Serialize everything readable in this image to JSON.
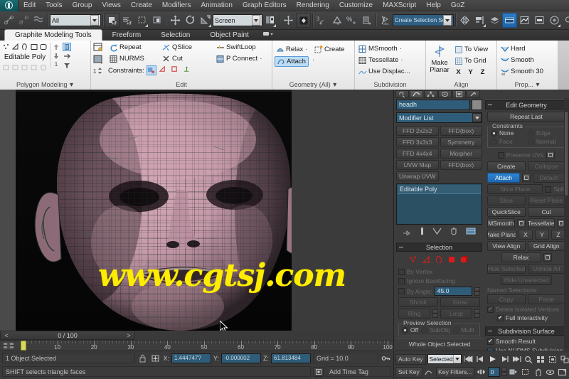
{
  "menubar": {
    "logo": "max-logo-icon",
    "items": [
      "Edit",
      "Tools",
      "Group",
      "Views",
      "Create",
      "Modifiers",
      "Animation",
      "Graph Editors",
      "Rendering",
      "Customize",
      "MAXScript",
      "Help",
      "GoZ"
    ]
  },
  "toolbar": {
    "selection_filter": "All",
    "reference_coord": "Screen",
    "named_selection_set": "Create Selection Set",
    "icons": [
      "undo-icon",
      "redo-icon",
      "select-link-icon",
      "unlink-icon",
      "bind-space-warp-icon",
      "select-object-icon",
      "select-by-name-icon",
      "rectangular-select-icon",
      "window-crossing-icon",
      "select-move-icon",
      "select-rotate-icon",
      "select-scale-icon",
      "use-pivot-center-icon",
      "select-manipulate-icon",
      "snap-toggle-icon",
      "angle-snap-icon",
      "percent-snap-icon",
      "spinner-snap-icon",
      "edit-named-sets-icon",
      "mirror-icon",
      "align-icon",
      "layer-manager-icon",
      "graphite-toggle-icon",
      "curve-editor-icon",
      "schematic-view-icon",
      "material-editor-icon",
      "render-setup-icon",
      "render-frame-icon"
    ]
  },
  "ribbon": {
    "tabs": [
      {
        "label": "Graphite Modeling Tools",
        "active": true
      },
      {
        "label": "Freeform",
        "active": false
      },
      {
        "label": "Selection",
        "active": false
      },
      {
        "label": "Object Paint",
        "active": false
      }
    ],
    "panels": [
      {
        "title": "Polygon Modeling",
        "subobject_label": "Editable Poly",
        "has_dropdown": true
      },
      {
        "title": "Edit",
        "buttons": [
          "Repeat",
          "QSlice",
          "SwiftLoop",
          "NURMS",
          "Cut",
          "P Connect"
        ],
        "constraints_label": "Constraints:",
        "spinner_value": "1"
      },
      {
        "title": "Geometry (All)",
        "buttons": [
          "Relax",
          "Create",
          "Attach"
        ],
        "selected": "Attach"
      },
      {
        "title": "Subdivision",
        "buttons": [
          "MSmooth",
          "Tessellate",
          "Use Displac..."
        ]
      },
      {
        "title": "Align",
        "make_planar": "Make Planar",
        "buttons": [
          "To View",
          "To Grid"
        ],
        "axes": [
          "X",
          "Y",
          "Z"
        ]
      },
      {
        "title": "Prop...",
        "buttons": [
          "Hard",
          "Smooth",
          "Smooth 30"
        ]
      }
    ]
  },
  "viewport": {
    "watermark": "www.cgtsj.com",
    "cursor": "arrow-cursor"
  },
  "command_panel": {
    "tabs": [
      "create-tab-icon",
      "modify-tab-icon",
      "hierarchy-tab-icon",
      "motion-tab-icon",
      "display-tab-icon",
      "utilities-tab-icon"
    ],
    "active_tab_index": 1,
    "object_name": "headh",
    "modifier_list_label": "Modifier List",
    "modifier_buttons": [
      "FFD 2x2x2",
      "FFD(box)",
      "FFD 3x3x3",
      "Symmetry",
      "FFD 4x4x4",
      "Morpher",
      "UVW Map",
      "FFD(box)",
      "Unwrap UVW",
      ""
    ],
    "stack": [
      "Editable Poly"
    ],
    "stack_icons": [
      "pin-stack-icon",
      "show-end-result-icon",
      "make-unique-icon",
      "remove-modifier-icon",
      "configure-modifier-sets-icon"
    ],
    "selection_rollout": {
      "title": "Selection",
      "sub_object_icons": [
        "vertex-icon",
        "edge-icon",
        "border-icon",
        "polygon-icon",
        "element-icon"
      ],
      "checkboxes": [
        {
          "label": "By Vertex",
          "checked": false
        },
        {
          "label": "Ignore Backfacing",
          "checked": false
        },
        {
          "label": "By Angle:",
          "checked": false
        }
      ],
      "by_angle_value": "45.0",
      "buttons": [
        "Shrink",
        "Grow",
        "Ring",
        "Loop"
      ],
      "preview_label": "Preview Selection",
      "preview_options": [
        "Off",
        "SubObj",
        "Multi"
      ],
      "preview_selected": "Off",
      "status": "Whole Object Selected"
    },
    "edit_geometry_rollout": {
      "title": "Edit Geometry",
      "repeat_last": "Repeat Last",
      "constraints_legend": "Constraints",
      "constraint_options": [
        "None",
        "Edge",
        "Face",
        "Normal"
      ],
      "constraint_selected": "None",
      "preserve_uvs": "Preserve UVs",
      "buttons": [
        "Create",
        "Collapse",
        "Attach",
        "Detach",
        "Slice Plane",
        "Split",
        "Slice",
        "Reset Plane",
        "QuickSlice",
        "Cut",
        "MSmooth",
        "Tessellate",
        "Make Planar",
        "View Align",
        "Grid Align",
        "Relax",
        "Hide Selected",
        "Unhide All",
        "Hide Unselected",
        "Copy",
        "Paste"
      ],
      "axes": [
        "X",
        "Y",
        "Z"
      ],
      "attach_active": true,
      "named_selections_label": "Named Selections:",
      "delete_isolated": "Delete Isolated Vertices",
      "full_interactivity": "Full Interactivity"
    },
    "subdivision_rollout": {
      "title": "Subdivision Surface",
      "smooth_result": "Smooth Result",
      "use_nurms": "Use NURMS Subdivision"
    }
  },
  "timeline": {
    "frame_display": "0 / 100",
    "prev_label": "<",
    "next_label": ">",
    "tick_labels": [
      "10",
      "20",
      "30",
      "40",
      "50",
      "60",
      "70",
      "80",
      "90",
      "100"
    ],
    "tick_values": [
      10,
      20,
      30,
      40,
      50,
      60,
      70,
      80,
      90,
      100
    ],
    "range_start": 0,
    "range_end": 100,
    "current_frame": 0
  },
  "statusbar": {
    "selection_status": "1 Object Selected",
    "prompt": "SHIFT selects triangle faces",
    "coord_labels": [
      "X:",
      "Y:",
      "Z:"
    ],
    "coord_values": [
      "1.444747?",
      "-0.000002",
      "61.813484"
    ],
    "grid": "Grid = 10.0",
    "add_time_tag": "Add Time Tag",
    "lock_icon": "lock-selection-icon",
    "absolute_icon": "absolute-mode-icon",
    "key_mode_icon": "key-mode-toggle-icon"
  },
  "animation_controls": {
    "auto_key": "Auto Key",
    "set_key": "Set Key",
    "key_filters": "Key Filters...",
    "selected_level": "Selected",
    "current_frame": "0",
    "playback_icons": [
      "go-to-start-icon",
      "previous-frame-icon",
      "play-animation-icon",
      "next-frame-icon",
      "go-to-end-icon",
      "key-mode-icon"
    ],
    "viewport_nav_icons": [
      "zoom-icon",
      "zoom-all-icon",
      "zoom-extents-icon",
      "zoom-region-icon",
      "field-of-view-icon",
      "pan-icon",
      "orbit-icon",
      "maximize-viewport-icon"
    ]
  },
  "colors": {
    "accent_blue": "#2b7dc9",
    "panel_bg": "#3c3c3c",
    "field_blue": "#2f5c78",
    "watermark_yellow": "#ffed00",
    "ribbon_bg": "#f0f0f0"
  }
}
